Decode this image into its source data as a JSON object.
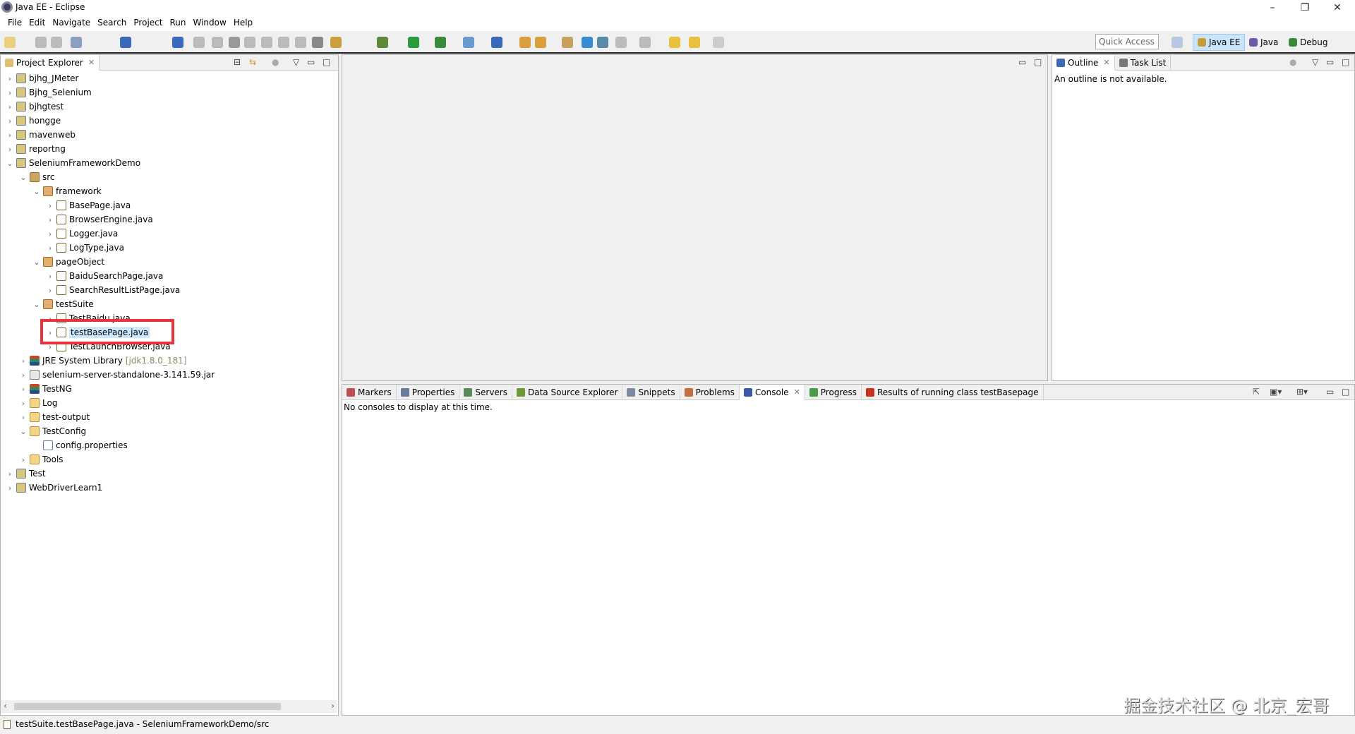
{
  "window": {
    "title": "Java EE - Eclipse",
    "minimize": "–",
    "restore": "❐",
    "close": "✕"
  },
  "menu": [
    "File",
    "Edit",
    "Navigate",
    "Search",
    "Project",
    "Run",
    "Window",
    "Help"
  ],
  "toolbar": {
    "quick_access_placeholder": "Quick Access",
    "perspectives": [
      {
        "label": "Java EE",
        "active": true,
        "color": "#c89a3a"
      },
      {
        "label": "Java",
        "active": false,
        "color": "#6a5aa8"
      },
      {
        "label": "Debug",
        "active": false,
        "color": "#3a8a3a"
      }
    ]
  },
  "project_explorer": {
    "title": "Project Explorer",
    "items": [
      {
        "label": "bjhg_JMeter",
        "level": 0,
        "exp": "closed",
        "icon": "project"
      },
      {
        "label": "Bjhg_Selenium",
        "level": 0,
        "exp": "closed",
        "icon": "project"
      },
      {
        "label": "bjhgtest",
        "level": 0,
        "exp": "closed",
        "icon": "project"
      },
      {
        "label": "hongge",
        "level": 0,
        "exp": "closed",
        "icon": "project"
      },
      {
        "label": "mavenweb",
        "level": 0,
        "exp": "closed",
        "icon": "project"
      },
      {
        "label": "reportng",
        "level": 0,
        "exp": "closed",
        "icon": "project"
      },
      {
        "label": "SeleniumFrameworkDemo",
        "level": 0,
        "exp": "open",
        "icon": "project"
      },
      {
        "label": "src",
        "level": 1,
        "exp": "open",
        "icon": "src"
      },
      {
        "label": "framework",
        "level": 2,
        "exp": "open",
        "icon": "pkg"
      },
      {
        "label": "BasePage.java",
        "level": 3,
        "exp": "closed",
        "icon": "java"
      },
      {
        "label": "BrowserEngine.java",
        "level": 3,
        "exp": "closed",
        "icon": "java"
      },
      {
        "label": "Logger.java",
        "level": 3,
        "exp": "closed",
        "icon": "java"
      },
      {
        "label": "LogType.java",
        "level": 3,
        "exp": "closed",
        "icon": "java"
      },
      {
        "label": "pageObject",
        "level": 2,
        "exp": "open",
        "icon": "pkg"
      },
      {
        "label": "BaiduSearchPage.java",
        "level": 3,
        "exp": "closed",
        "icon": "java"
      },
      {
        "label": "SearchResultListPage.java",
        "level": 3,
        "exp": "closed",
        "icon": "java"
      },
      {
        "label": "testSuite",
        "level": 2,
        "exp": "open",
        "icon": "pkg"
      },
      {
        "label": "TestBaidu.java",
        "level": 3,
        "exp": "closed",
        "icon": "java"
      },
      {
        "label": "testBasePage.java",
        "level": 3,
        "exp": "closed",
        "icon": "java",
        "selected": true
      },
      {
        "label": "TestLaunchBrowser.java",
        "level": 3,
        "exp": "closed",
        "icon": "java"
      },
      {
        "label": "JRE System Library",
        "suffix": "[jdk1.8.0_181]",
        "level": 1,
        "exp": "closed",
        "icon": "lib"
      },
      {
        "label": "selenium-server-standalone-3.141.59.jar",
        "level": 1,
        "exp": "closed",
        "icon": "jar"
      },
      {
        "label": "TestNG",
        "level": 1,
        "exp": "closed",
        "icon": "lib"
      },
      {
        "label": "Log",
        "level": 1,
        "exp": "closed",
        "icon": "folder"
      },
      {
        "label": "test-output",
        "level": 1,
        "exp": "closed",
        "icon": "folder"
      },
      {
        "label": "TestConfig",
        "level": 1,
        "exp": "open",
        "icon": "folder"
      },
      {
        "label": "config.properties",
        "level": 2,
        "exp": "none",
        "icon": "file"
      },
      {
        "label": "Tools",
        "level": 1,
        "exp": "closed",
        "icon": "folder"
      },
      {
        "label": "Test",
        "level": 0,
        "exp": "closed",
        "icon": "project"
      },
      {
        "label": "WebDriverLearn1",
        "level": 0,
        "exp": "closed",
        "icon": "project"
      }
    ]
  },
  "outline": {
    "tabs": [
      {
        "label": "Outline",
        "active": true,
        "color": "#3a6ab8"
      },
      {
        "label": "Task List",
        "active": false,
        "color": "#777"
      }
    ],
    "message": "An outline is not available."
  },
  "bottom": {
    "tabs": [
      {
        "label": "Markers",
        "color": "#c05050"
      },
      {
        "label": "Properties",
        "color": "#6a7a9a"
      },
      {
        "label": "Servers",
        "color": "#5a8a5a"
      },
      {
        "label": "Data Source Explorer",
        "color": "#6a9a3a"
      },
      {
        "label": "Snippets",
        "color": "#7a8aa0"
      },
      {
        "label": "Problems",
        "color": "#c07040"
      },
      {
        "label": "Console",
        "color": "#3a5aa8",
        "active": true
      },
      {
        "label": "Progress",
        "color": "#4a9a4a"
      },
      {
        "label": "Results of running class testBasepage",
        "color": "#c83020"
      }
    ],
    "message": "No consoles to display at this time."
  },
  "status": {
    "text": "testSuite.testBasePage.java - SeleniumFrameworkDemo/src"
  },
  "watermark": "掘金技术社区 @ 北京_宏哥"
}
